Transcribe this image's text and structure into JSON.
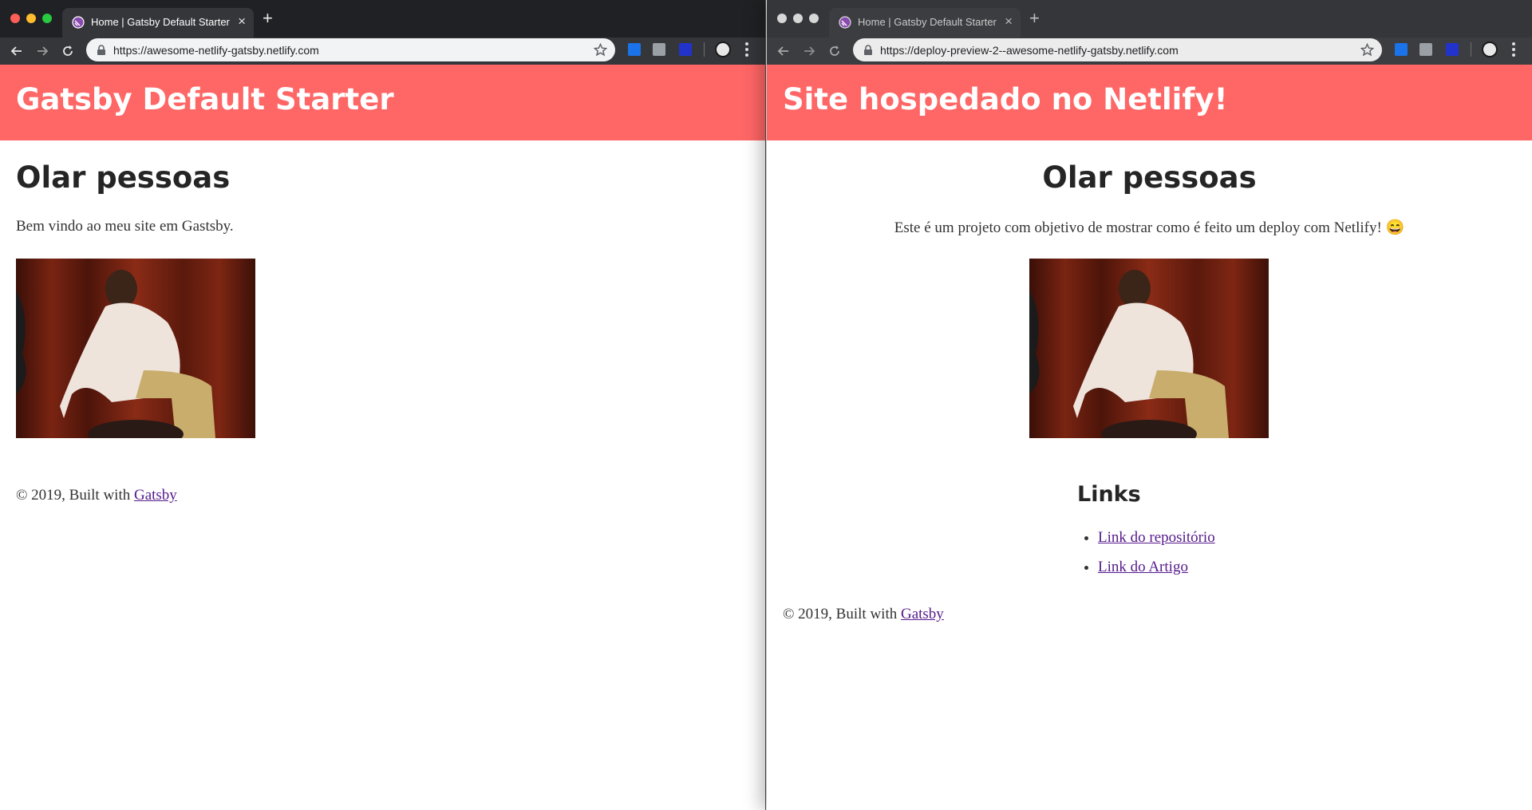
{
  "left": {
    "tab_title": "Home | Gatsby Default Starter",
    "url": "https://awesome-netlify-gatsby.netlify.com",
    "site_title": "Gatsby Default Starter",
    "heading": "Olar pessoas",
    "intro": "Bem vindo ao meu site em Gastsby.",
    "footer_text": "© 2019, Built with ",
    "footer_link": "Gatsby"
  },
  "right": {
    "tab_title": "Home | Gatsby Default Starter",
    "url": "https://deploy-preview-2--awesome-netlify-gatsby.netlify.com",
    "site_title": "Site hospedado no Netlify!",
    "heading": "Olar pessoas",
    "intro": "Este é um projeto com objetivo de mostrar como é feito um deploy com Netlify! 😄",
    "links_heading": "Links",
    "links": [
      {
        "label": "Link do repositório"
      },
      {
        "label": "Link do Artigo"
      }
    ],
    "footer_text": "© 2019, Built with ",
    "footer_link": "Gatsby"
  },
  "icons": {
    "favicon": "gatsby-logo-icon",
    "lock": "lock-icon",
    "star": "star-icon",
    "tab_close": "×",
    "new_tab": "+"
  },
  "colors": {
    "header_bg": "#ff6666",
    "link": "#551a8b"
  }
}
